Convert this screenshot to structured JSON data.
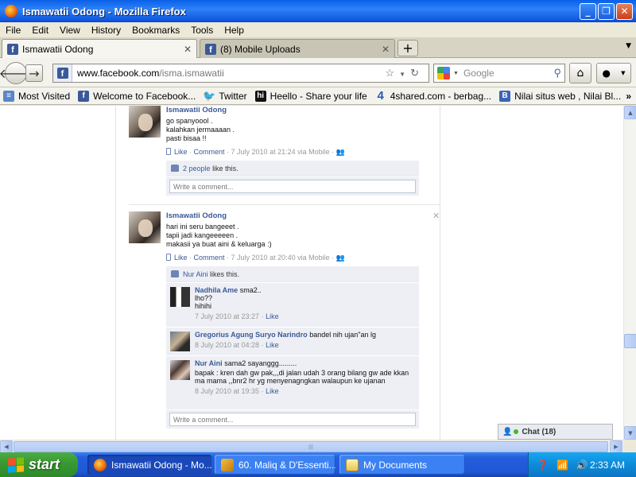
{
  "window": {
    "title": "Ismawatii Odong - Mozilla Firefox",
    "minimize": "_",
    "maximize": "❐",
    "close": "✕"
  },
  "menu": [
    "File",
    "Edit",
    "View",
    "History",
    "Bookmarks",
    "Tools",
    "Help"
  ],
  "tabs": [
    {
      "label": "Ismawatii Odong",
      "active": true
    },
    {
      "label": "(8) Mobile Uploads",
      "active": false
    }
  ],
  "nav": {
    "url_domain": "www.facebook.com",
    "url_path": "/isma.ismawatii",
    "search_placeholder": "Google"
  },
  "bookmarks": [
    {
      "label": "Most Visited",
      "icon": "most-visited-icon"
    },
    {
      "label": "Welcome to Facebook...",
      "icon": "facebook-icon"
    },
    {
      "label": "Twitter",
      "icon": "twitter-bird-icon"
    },
    {
      "label": "Heello - Share your life",
      "icon": "heello-icon"
    },
    {
      "label": "4shared.com - berbag...",
      "icon": "4shared-icon"
    },
    {
      "label": "Nilai situs web , Nilai Bl...",
      "icon": "blog-icon"
    }
  ],
  "bookmarks_more": "»",
  "posts": [
    {
      "author": "Ismawatii Odong",
      "lines": [
        "go spanyoool .",
        "kalahkan jermaaaan .",
        "pasti bisaa !!"
      ],
      "like": "Like",
      "comment": "Comment",
      "meta": "7 July 2010 at 21:24 via Mobile",
      "likes_count": "2 people",
      "likes_suffix": "like this.",
      "comment_placeholder": "Write a comment..."
    },
    {
      "author": "Ismawatii Odong",
      "lines": [
        "hari ini seru bangeeet .",
        "tapii jadi kangeeeeen .",
        "makasii ya buat aini & keluarga :)"
      ],
      "like": "Like",
      "comment": "Comment",
      "meta": "7 July 2010 at 20:40 via Mobile",
      "liker": "Nur Aini",
      "likes_suffix": "likes this.",
      "comments": [
        {
          "name": "Nadhila Ame",
          "text": "sma2..",
          "extra": "lho??\nhihihi",
          "time": "7 July 2010 at 23:27",
          "like": "Like"
        },
        {
          "name": "Gregorius Agung Suryo Narindro",
          "text": "bandel nih ujan\"an lg",
          "extra": "",
          "time": "8 July 2010 at 04:28",
          "like": "Like"
        },
        {
          "name": "Nur Aini",
          "text": "sama2 sayanggg.........",
          "extra": "bapak : kren dah gw pak,,,di jalan udah 3 orang bilang gw ade kkan ma mama ,,bnr2 hr yg menyenagngkan walaupun ke ujanan",
          "time": "8 July 2010 at 19:35",
          "like": "Like"
        }
      ],
      "comment_placeholder": "Write a comment..."
    }
  ],
  "chat": {
    "label": "Chat (18)"
  },
  "taskbar": {
    "start": "start",
    "tasks": [
      {
        "label": "Ismawatii Odong - Mo...",
        "active": true
      },
      {
        "label": "60. Maliq & D'Essenti...",
        "active": false
      },
      {
        "label": "My Documents",
        "active": false
      }
    ],
    "clock": "2:33 AM"
  }
}
